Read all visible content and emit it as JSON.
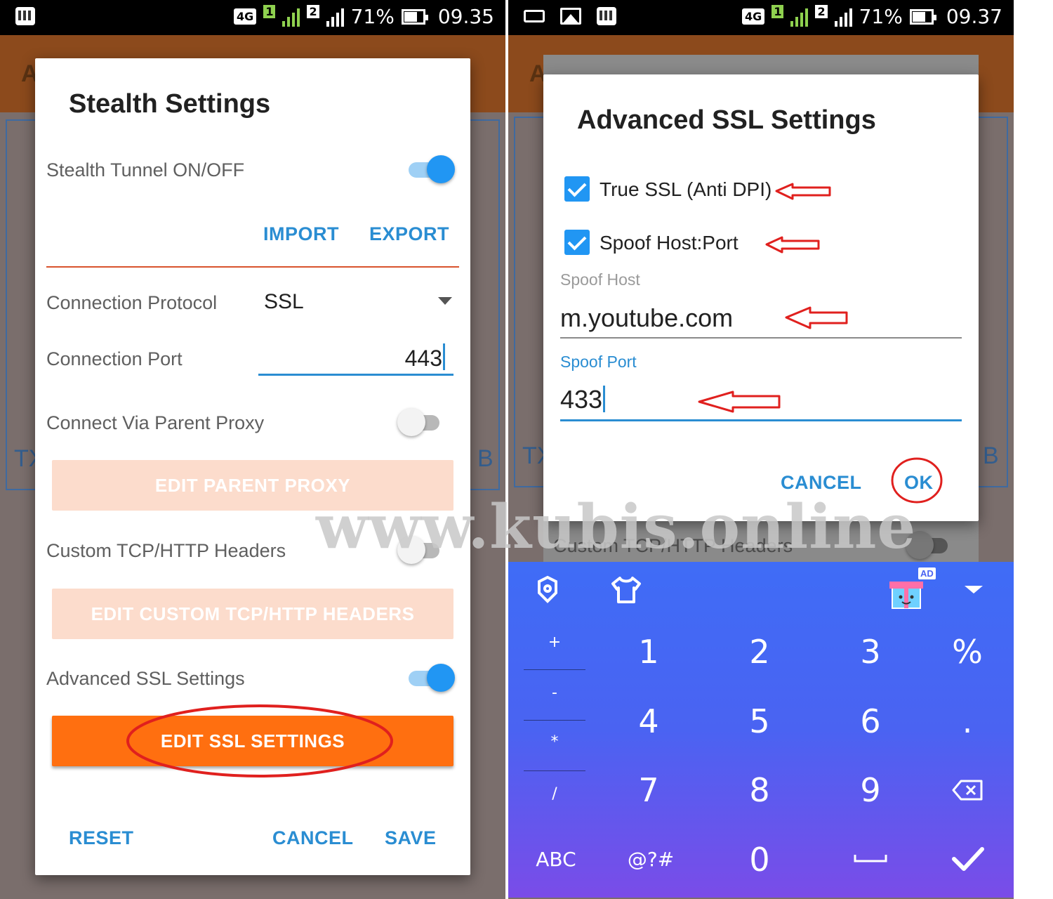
{
  "watermark": "www.kubis.online",
  "left": {
    "status": {
      "network": "4G",
      "sim1": "1",
      "sim2": "2",
      "battery": "71%",
      "time": "09.35"
    },
    "bg_labels": {
      "tx": "TX",
      "b": "B",
      "a": "A"
    },
    "dialog": {
      "title": "Stealth Settings",
      "stealth_tunnel": {
        "label": "Stealth Tunnel ON/OFF",
        "on": true
      },
      "import_label": "IMPORT",
      "export_label": "EXPORT",
      "protocol": {
        "label": "Connection Protocol",
        "value": "SSL"
      },
      "port": {
        "label": "Connection Port",
        "value": "443"
      },
      "parent_proxy": {
        "label": "Connect Via Parent Proxy",
        "on": false,
        "button": "EDIT PARENT PROXY"
      },
      "custom_headers": {
        "label": "Custom TCP/HTTP Headers",
        "on": false,
        "button": "EDIT CUSTOM TCP/HTTP HEADERS"
      },
      "advanced_ssl": {
        "label": "Advanced SSL Settings",
        "on": true,
        "button": "EDIT SSL SETTINGS"
      },
      "reset_label": "RESET",
      "cancel_label": "CANCEL",
      "save_label": "SAVE"
    }
  },
  "right": {
    "status": {
      "network": "4G",
      "sim1": "1",
      "sim2": "2",
      "battery": "71%",
      "time": "09.37"
    },
    "bg_labels": {
      "tx": "TX",
      "b": "B",
      "a": "A",
      "custom_headers": "Custom TCP/HTTP Headers"
    },
    "dialog": {
      "title": "Advanced SSL Settings",
      "true_ssl": {
        "label": "True SSL (Anti DPI)",
        "checked": true
      },
      "spoof_hostport": {
        "label": "Spoof Host:Port",
        "checked": true
      },
      "spoof_host": {
        "hint": "Spoof Host",
        "value": "m.youtube.com"
      },
      "spoof_port": {
        "hint": "Spoof Port",
        "value": "433"
      },
      "cancel_label": "CANCEL",
      "ok_label": "OK"
    },
    "keyboard": {
      "ad_badge": "AD",
      "symbols": [
        "+",
        "-",
        "*",
        "/"
      ],
      "digits": [
        "1",
        "2",
        "3",
        "4",
        "5",
        "6",
        "7",
        "8",
        "9",
        "0"
      ],
      "percent": "%",
      "dot": ".",
      "abc": "ABC",
      "sym": "@?#",
      "icons": {
        "backspace": "backspace-icon",
        "enter": "check-icon",
        "space": "space-icon",
        "collapse": "chevron-down-icon",
        "theme": "tshirt-icon",
        "gift": "gift-icon"
      }
    }
  },
  "colors": {
    "accent_blue": "#2a8dd2",
    "switch_blue": "#2196f3",
    "orange_button": "#ff6f10",
    "annotation_red": "#e0201e"
  }
}
